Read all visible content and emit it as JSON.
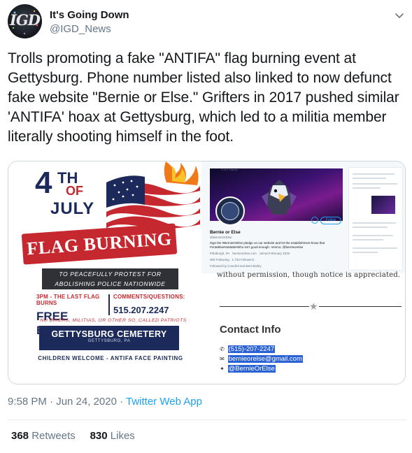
{
  "author": {
    "name": "It's Going Down",
    "handle": "@IGD_News",
    "avatar_text": "IGD"
  },
  "tweet": {
    "text": "Trolls promoting a fake \"ANTIFA\" flag burning event at Gettysburg. Phone number listed also linked to now defunct fake website \"Bernie or Else.\" Grifters in 2017 pushed similar 'ANTIFA' hoax at Gettysburg, which led to a militia member literally shooting himself in the foot.",
    "time": "9:58 PM · Jun 24, 2020",
    "separator": " · ",
    "client": "Twitter Web App",
    "retweets_count": "368",
    "retweets_label": "Retweets",
    "likes_count": "830",
    "likes_label": "Likes"
  },
  "poster": {
    "num": "4",
    "th": "TH",
    "of": "OF",
    "july": "JULY",
    "ribbon": "FLAG BURNING",
    "banner": "TO PEACEFULLY PROTEST FOR ABOLISHING POLICE NATIONWIDE",
    "left_small": "3PM - THE LAST FLAG BURNS",
    "free_entry": "FREE ENTRY",
    "right_small": "COMMENTS/QUESTIONS:",
    "phone": "515.207.2247",
    "no_bikers": "NO BIKERS, MILITIAS, OR OTHER SO_CALLED PATRIOTS",
    "cemetery": "GETTYSBURG CEMETERY",
    "cemetery_sub": "GETTYSBURG, PA",
    "children": "CHILDREN WELCOME - ANTIFA FACE PAINTING"
  },
  "screenshot": {
    "tweets_count": "2,410 Tweets",
    "profile_name": "Bernie or Else",
    "profile_handle": "@BernieOrElse",
    "bio": "Sign the #BernieOrElse pledge on our website and let the establishment know that #VoteBlueNoMatterWho isn't good enough. Venmo: @bernieorelse",
    "location": "Pittsburgh, PA",
    "site": "bernieorelse.com",
    "joined": "Joined February 2020",
    "following": "300 Following",
    "followers": "1,733 Followers",
    "followed_by": "Followed by Coachid and Bert Bailey",
    "follow_btn": "Follow",
    "cutoff_text": "without permission, though notice is appreciated.",
    "contact_title": "Contact Info",
    "contact_phone": "(515)-207-2247",
    "contact_email": "bernieorelse@gmail.com",
    "contact_twitter": "@BernieOrElse"
  },
  "colors": {
    "accent": "#1da1f2",
    "poster_navy": "#1b2a5a",
    "poster_red": "#c6282f",
    "highlight": "#2a62d6"
  }
}
